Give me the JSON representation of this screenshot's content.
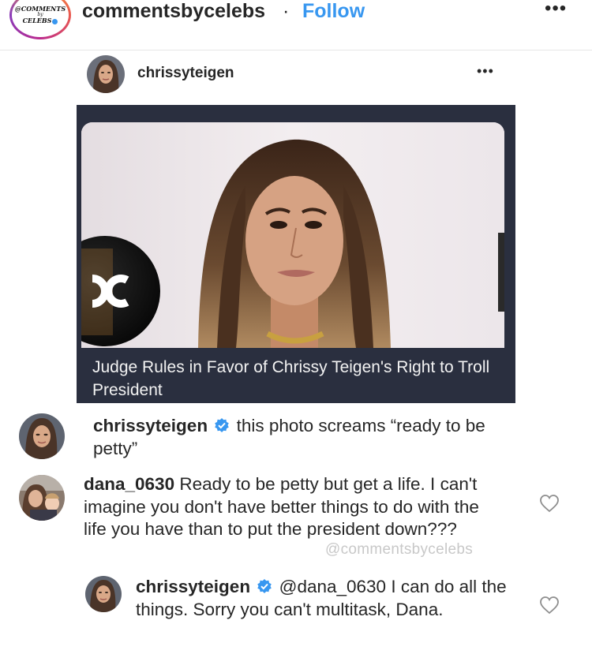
{
  "header": {
    "account_name": "commentsbycelebs",
    "separator": "·",
    "follow_label": "Follow",
    "more_label": "•••",
    "logo_top": "@COMMENTS",
    "logo_by": "by",
    "logo_bottom": "CELEBS"
  },
  "post": {
    "username": "chrissyteigen",
    "more_label": "•••",
    "headline": "Judge Rules in Favor of Chrissy Teigen's Right to Troll President",
    "photo_logo_text": "C"
  },
  "comments": [
    {
      "username": "chrissyteigen",
      "verified": true,
      "text": "this photo screams “ready to be petty”"
    },
    {
      "username": "dana_0630",
      "verified": false,
      "text": "Ready to be petty but get a life. I can't imagine you don't have better things to do with the life you have than to put the president down???"
    },
    {
      "username": "chrissyteigen",
      "verified": true,
      "mention": "@dana_0630",
      "text": "I can do all the things. Sorry you can't multitask, Dana."
    }
  ],
  "watermark": "@commentsbycelebs",
  "colors": {
    "link_blue": "#3897f0",
    "text": "#262626",
    "card_bg": "#2a2f3f",
    "verified_blue": "#3897f0"
  },
  "icons": [
    "more-icon",
    "verified-badge-icon",
    "heart-icon"
  ]
}
